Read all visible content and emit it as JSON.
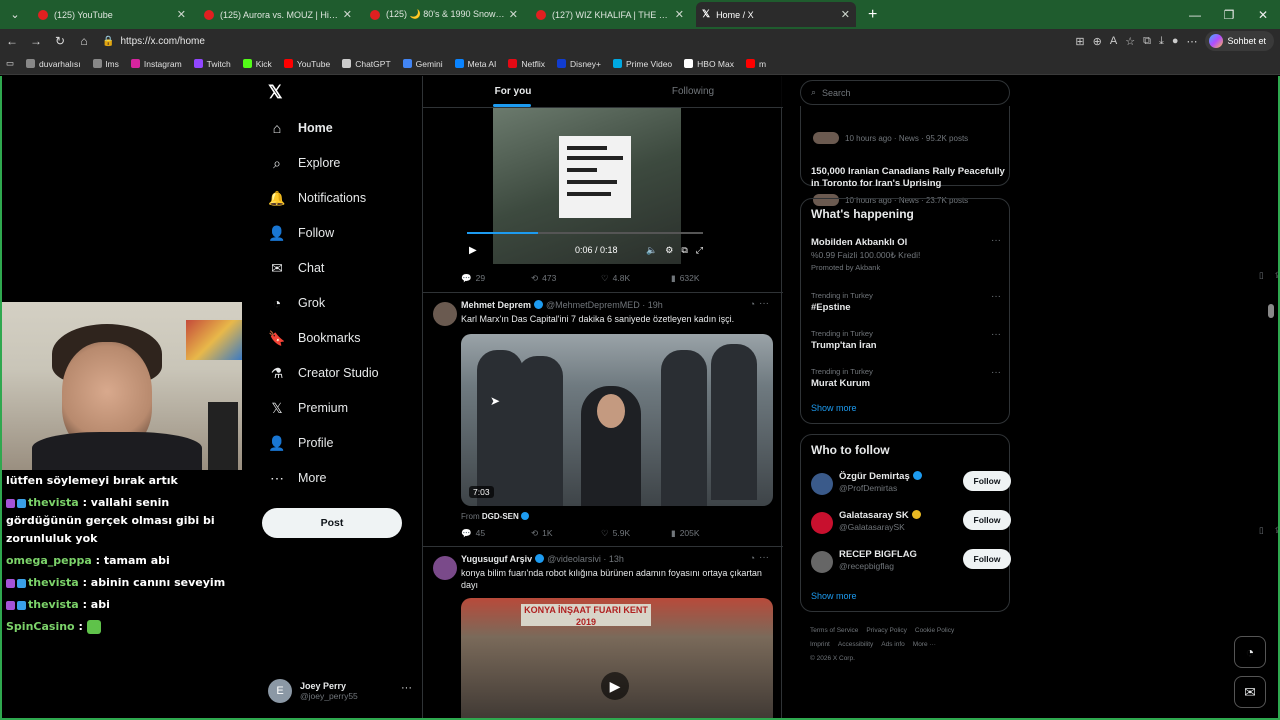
{
  "browser": {
    "tabs": [
      {
        "title": "(125) YouTube",
        "type": "youtube"
      },
      {
        "title": "(125) Aurora vs. MOUZ | Highlights",
        "type": "youtube"
      },
      {
        "title": "(125) 🌙 80's & 1990 Snowfall Ou",
        "type": "youtube"
      },
      {
        "title": "(127) WIZ KHALIFA | THE SESH EP",
        "type": "youtube"
      },
      {
        "title": "Home / X",
        "type": "x",
        "active": true
      }
    ],
    "url": "https://x.com/home",
    "copilot_label": "Sohbet et",
    "bookmarks": [
      {
        "label": "duvarhalısı",
        "color": "#888888"
      },
      {
        "label": "lms",
        "color": "#888888"
      },
      {
        "label": "Instagram",
        "color": "#d6249f"
      },
      {
        "label": "Twitch",
        "color": "#9146ff"
      },
      {
        "label": "Kick",
        "color": "#53fc18"
      },
      {
        "label": "YouTube",
        "color": "#ff0000"
      },
      {
        "label": "ChatGPT",
        "color": "#cccccc"
      },
      {
        "label": "Gemini",
        "color": "#4285f4"
      },
      {
        "label": "Meta AI",
        "color": "#0a84ff"
      },
      {
        "label": "Netflix",
        "color": "#e50914"
      },
      {
        "label": "Disney+",
        "color": "#113ccf"
      },
      {
        "label": "Prime Video",
        "color": "#00a8e1"
      },
      {
        "label": "HBO Max",
        "color": "#ffffff"
      },
      {
        "label": "m",
        "color": "#ff0000"
      }
    ]
  },
  "nav": {
    "items": [
      {
        "label": "Home",
        "icon": "home-icon",
        "glyph": "⌂"
      },
      {
        "label": "Explore",
        "icon": "search-icon",
        "glyph": "⌕"
      },
      {
        "label": "Notifications",
        "icon": "bell-icon",
        "glyph": "🔔"
      },
      {
        "label": "Follow",
        "icon": "person-plus-icon",
        "glyph": "👤"
      },
      {
        "label": "Chat",
        "icon": "mail-icon",
        "glyph": "✉"
      },
      {
        "label": "Grok",
        "icon": "grok-icon",
        "glyph": "◔"
      },
      {
        "label": "Bookmarks",
        "icon": "bookmark-icon",
        "glyph": "🔖"
      },
      {
        "label": "Creator Studio",
        "icon": "flask-icon",
        "glyph": "⚗"
      },
      {
        "label": "Premium",
        "icon": "x-icon",
        "glyph": "𝕏"
      },
      {
        "label": "Profile",
        "icon": "person-icon",
        "glyph": "👤"
      },
      {
        "label": "More",
        "icon": "more-circle-icon",
        "glyph": "⋯"
      }
    ],
    "post_label": "Post",
    "account": {
      "initial": "E",
      "name": "Joey Perry",
      "handle": "@joey_perry55"
    }
  },
  "stream_chat": [
    {
      "user": "",
      "text": "lütfen söylemeyi bırak artık",
      "badges": false
    },
    {
      "user": "thevista",
      "text": ": vallahi senin gördüğünün gerçek olması gibi bi zorunluluk yok",
      "badges": true
    },
    {
      "user": "omega_peppa",
      "text": ": tamam abi",
      "badges": false
    },
    {
      "user": "thevista",
      "text": ": abinin canını seveyim",
      "badges": true
    },
    {
      "user": "thevista",
      "text": ": abi",
      "badges": true
    },
    {
      "user": "SpinCasino",
      "text": ":",
      "badges": false,
      "emote": true
    }
  ],
  "feed": {
    "tabs": [
      "For you",
      "Following"
    ],
    "post1": {
      "video_time": "0:06 / 0:18",
      "stats": {
        "replies": "29",
        "reposts": "473",
        "likes": "4.8K",
        "views": "632K"
      }
    },
    "post2": {
      "name": "Mehmet Deprem",
      "handle": "@MehmetDepremMED",
      "time": "· 19h",
      "text": "Karl Marx'ın Das Capital'ini 7 dakika 6 saniyede özetleyen kadın işçi.",
      "duration": "7:03",
      "from_prefix": "From",
      "from_account": "DGD-SEN",
      "stats": {
        "replies": "45",
        "reposts": "1K",
        "likes": "5.9K",
        "views": "205K"
      }
    },
    "post3": {
      "name": "Yugusuguf Arşiv",
      "handle": "@videolarsivi",
      "time": "· 13h",
      "text": "konya bilim fuarı'nda robot kılığına bürünen adamın foyasını ortaya çıkartan dayı",
      "banner": "KONYA İNŞAAT FUARI KENT 2019"
    }
  },
  "right": {
    "search_placeholder": "Search",
    "news_top_meta": "10 hours ago · News · 95.2K posts",
    "news_title": "150,000 Iranian Canadians Rally Peacefully in Toronto for Iran's Uprising",
    "news_meta": "10 hours ago · News · 23.7K posts",
    "whats_happening": "What's happening",
    "trends": [
      {
        "context": "",
        "title": "Mobilden Akbanklı Ol",
        "sub": "%0.99 Faizli 100.000₺ Kredi!",
        "promo": "Promoted by Akbank"
      },
      {
        "context": "Trending in Turkey",
        "title": "#Epstine"
      },
      {
        "context": "Trending in Turkey",
        "title": "Trump'tan İran"
      },
      {
        "context": "Trending in Turkey",
        "title": "Murat Kurum"
      }
    ],
    "show_more": "Show more",
    "who_to_follow": "Who to follow",
    "suggestions": [
      {
        "name": "Özgür Demirtaş",
        "handle": "@ProfDemirtas",
        "verified_color": "#1d9bf0",
        "avatar_color": "#3a5a8a"
      },
      {
        "name": "Galatasaray SK",
        "handle": "@GalatasaraySK",
        "verified_color": "#e8b923",
        "avatar_color": "#c8102e"
      },
      {
        "name": "RECEP BIGFLAG",
        "handle": "@recepbigflag",
        "verified_color": "",
        "avatar_color": "#666666"
      }
    ],
    "follow_label": "Follow",
    "show_more2": "Show more",
    "footer": [
      "Terms of Service",
      "Privacy Policy",
      "Cookie Policy",
      "Imprint",
      "Accessibility",
      "Ads info",
      "More ···",
      "© 2026 X Corp."
    ]
  }
}
